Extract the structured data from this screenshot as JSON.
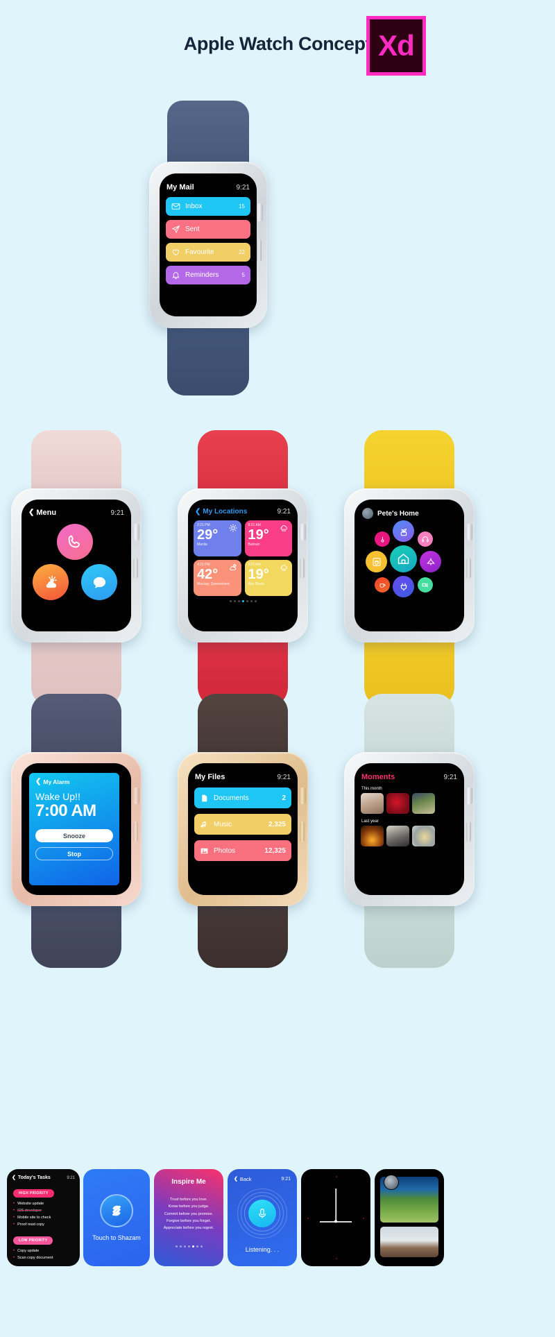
{
  "header": {
    "title": "Apple Watch Concept",
    "logo_text": "Xd",
    "logo_name": "adobe-xd-logo",
    "accent_title_color": "#162338",
    "logo_color": "#FF2BC2",
    "page_background": "#E0F4FB"
  },
  "mail_watch": {
    "band_color": "#4A5E80",
    "case_color": "#DDE2E6",
    "screen": {
      "title": "My Mail",
      "time": "9:21",
      "rows": [
        {
          "icon": "envelope-icon",
          "label": "Inbox",
          "count": "15",
          "color": "#1FC6F5"
        },
        {
          "icon": "paper-plane-icon",
          "label": "Sent",
          "count": "",
          "color": "#F97182"
        },
        {
          "icon": "heart-icon",
          "label": "Favourite",
          "count": "22",
          "color": "#F2CF66"
        },
        {
          "icon": "bell-icon",
          "label": "Reminders",
          "count": "5",
          "color": "#B368E8"
        }
      ]
    }
  },
  "menu_watch": {
    "band_color": "#E8CFCE",
    "case_color": "#E4E7EA",
    "screen": {
      "back_label": "Menu",
      "time": "9:21",
      "apps": [
        {
          "name": "phone-app-icon",
          "glyph": "phone",
          "from": "#F06AC8",
          "to": "#F96E8E"
        },
        {
          "name": "weather-app-icon",
          "glyph": "weather",
          "from": "#FBB040",
          "to": "#F4543C"
        },
        {
          "name": "messages-app-icon",
          "glyph": "message",
          "from": "#1FC6F5",
          "to": "#2E9BF0"
        }
      ]
    }
  },
  "locations_watch": {
    "band_color": "#E03A4C",
    "case_color": "#DDE2E6",
    "screen": {
      "back_label": "My Locations",
      "title_color": "#2E9BF0",
      "time": "9:21",
      "cards": [
        {
          "time": "2:21 PM",
          "temp": "29°",
          "city": "Manila",
          "icon": "sun-icon",
          "color": "#6F7FEB"
        },
        {
          "time": "9:21 AM",
          "temp": "19°",
          "city": "Bahrain",
          "icon": "rain-cloud-icon",
          "color": "#F93D86"
        },
        {
          "time": "4:21 PM",
          "temp": "42°",
          "city": "Mackay, Queensland",
          "icon": "partly-sunny-icon",
          "color": "#F99279"
        },
        {
          "time": "9:21 AM",
          "temp": "19°",
          "city": "Abu Dhabi",
          "icon": "rain-cloud-icon",
          "color": "#F2D85E"
        }
      ],
      "page_dots": 7,
      "active_dot": 4
    }
  },
  "home_watch": {
    "band_color": "#F2CE2E",
    "case_color": "#DDE2E6",
    "screen": {
      "title": "Pete's Home",
      "avatar": "user-avatar",
      "tiles": [
        {
          "name": "thermometer-icon",
          "color": "#E8177F",
          "glyph": "thermo",
          "size": "s"
        },
        {
          "name": "plant-icon",
          "color": "#6C5CE7",
          "glyph": "plant",
          "size": "m"
        },
        {
          "name": "headphones-icon",
          "color": "#F67FC0",
          "glyph": "headphones",
          "size": "s"
        },
        {
          "name": "washer-icon",
          "color": "#F7C131",
          "glyph": "washer",
          "size": "m"
        },
        {
          "name": "home-icon",
          "color": "#17C3B2",
          "glyph": "home",
          "size": "l"
        },
        {
          "name": "lamp-icon",
          "color": "#B02AD6",
          "glyph": "lamp",
          "size": "m"
        },
        {
          "name": "coffee-icon",
          "color": "#F4402A",
          "glyph": "coffee",
          "size": "s"
        },
        {
          "name": "plug-icon",
          "color": "#5A46E0",
          "glyph": "plug",
          "size": "m"
        },
        {
          "name": "camera-icon",
          "color": "#45DDA0",
          "glyph": "camera",
          "size": "s"
        }
      ]
    }
  },
  "alarm_watch": {
    "band_color": "#4B5068",
    "case_color": "#EFC6B8",
    "screen": {
      "back_label": "My Alarm",
      "heading": "Wake Up!!",
      "time_display": "7:00 AM",
      "snooze_label": "Snooze",
      "stop_label": "Stop",
      "gradient_from": "#12C8F0",
      "gradient_to": "#1064E8"
    }
  },
  "files_watch": {
    "band_color": "#4A3C3A",
    "case_color": "#E9CBA0",
    "screen": {
      "title": "My Files",
      "time": "9:21",
      "rows": [
        {
          "icon": "document-icon",
          "label": "Documents",
          "count": "2",
          "color": "#1FC6F5"
        },
        {
          "icon": "music-note-icon",
          "label": "Music",
          "count": "2,325",
          "color": "#F2CF66"
        },
        {
          "icon": "photo-icon",
          "label": "Photos",
          "count": "12,325",
          "color": "#F9717F"
        }
      ]
    }
  },
  "moments_watch": {
    "band_color": "#CBDDD9",
    "case_color": "#DDE2E6",
    "screen": {
      "title": "Moments",
      "title_color": "#F9326B",
      "time": "9:21",
      "sections": [
        {
          "label": "This month",
          "photos": [
            "pug-photo",
            "red-flower-photo",
            "mountain-photo"
          ]
        },
        {
          "label": "Last year",
          "photos": [
            "campfire-photo",
            "surfers-photo",
            "food-bowl-photo"
          ]
        }
      ]
    }
  },
  "mini_cards": [
    {
      "name": "tasks-card",
      "back_label": "Today's Tasks",
      "time": "9:21",
      "groups": [
        {
          "badge": "HIGH PRIORITY",
          "items": [
            {
              "text": "Website update",
              "done": false
            },
            {
              "text": "iOS developer",
              "done": true
            },
            {
              "text": "Mobile site to check",
              "done": false
            },
            {
              "text": "Proof read copy",
              "done": false
            }
          ]
        },
        {
          "badge": "LOW PRIORITY",
          "items": [
            {
              "text": "Copy update",
              "done": false
            },
            {
              "text": "Scan copy document",
              "done": false
            }
          ]
        }
      ]
    },
    {
      "name": "shazam-card",
      "label": "Touch to Shazam",
      "icon": "shazam-icon",
      "bg_from": "#2E7BF6",
      "bg_to": "#2E6AF0"
    },
    {
      "name": "inspire-card",
      "title": "Inspire Me",
      "lines": [
        "Trust before you love.",
        "Know before you judge.",
        "Commit before you promise.",
        "Forgive before you forget.",
        "Appreciate before you regret."
      ],
      "bg_from": "#F9326B",
      "bg_to": "#2E5BD8",
      "page_dots": 7,
      "active_dot": 5
    },
    {
      "name": "siri-card",
      "back_label": "Back",
      "time": "9:21",
      "status": "Listening. . .",
      "icon": "microphone-icon",
      "bg_from": "#2E5BD8",
      "bg_to": "#2E6AF0"
    },
    {
      "name": "clock-face-card",
      "icon": "analog-clock-hands",
      "bg": "#000000"
    },
    {
      "name": "photo-feed-card",
      "avatar": "user-avatar",
      "photos": [
        "lake-forest-photo",
        "hiker-ridge-photo"
      ]
    }
  ]
}
